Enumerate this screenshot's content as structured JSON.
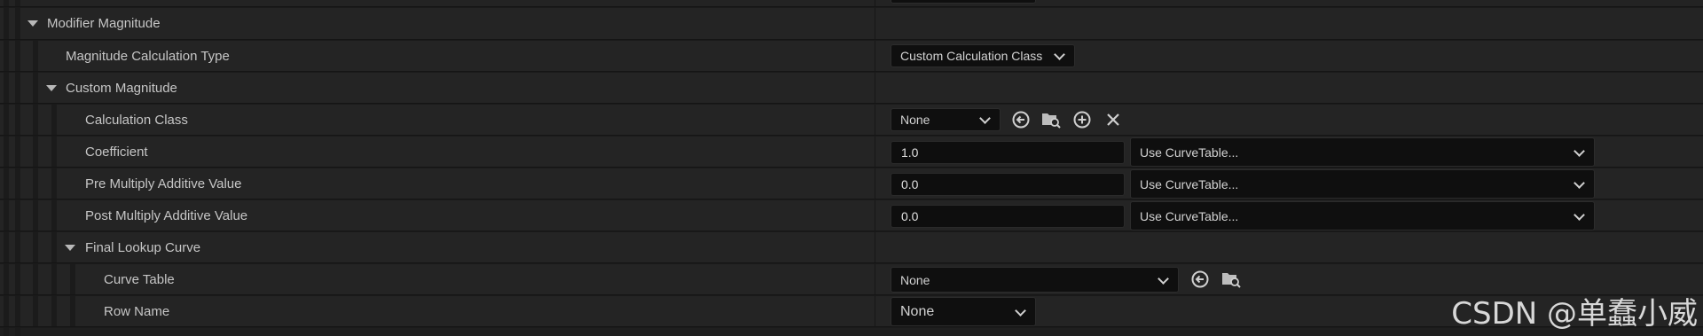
{
  "rows": {
    "modifier_magnitude": {
      "label": "Modifier Magnitude"
    },
    "magnitude_calc_type": {
      "label": "Magnitude Calculation Type",
      "value": "Custom Calculation Class"
    },
    "custom_magnitude": {
      "label": "Custom Magnitude"
    },
    "calculation_class": {
      "label": "Calculation Class",
      "value": "None"
    },
    "coefficient": {
      "label": "Coefficient",
      "value": "1.0",
      "curve": "Use CurveTable..."
    },
    "pre_multiply": {
      "label": "Pre Multiply Additive Value",
      "value": "0.0",
      "curve": "Use CurveTable..."
    },
    "post_multiply": {
      "label": "Post Multiply Additive Value",
      "value": "0.0",
      "curve": "Use CurveTable..."
    },
    "final_lookup_curve": {
      "label": "Final Lookup Curve"
    },
    "curve_table": {
      "label": "Curve Table",
      "value": "None"
    },
    "row_name": {
      "label": "Row Name",
      "value": "None"
    }
  },
  "watermark": "CSDN @单蠢小威",
  "icons": [
    "use-selected-icon",
    "browse-icon",
    "add-icon",
    "clear-icon"
  ],
  "colors": {
    "background": "#1a1a1a",
    "row": "#242424",
    "field": "#0f0f0f",
    "text": "#c6c6c6"
  }
}
